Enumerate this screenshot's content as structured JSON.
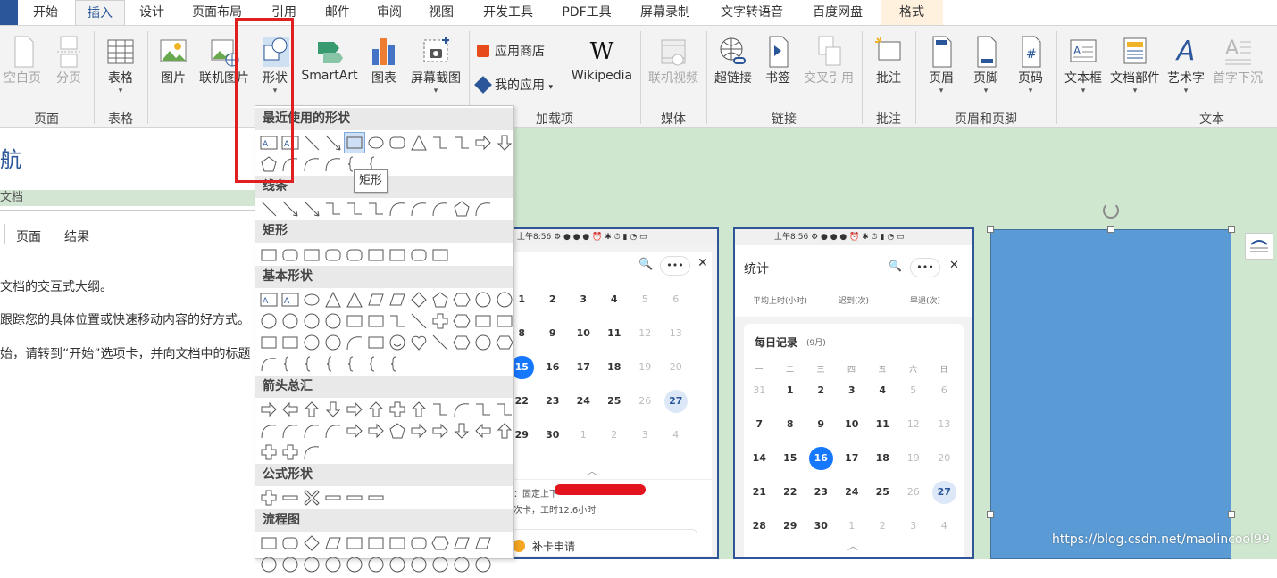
{
  "tabs": [
    "开始",
    "插入",
    "设计",
    "页面布局",
    "引用",
    "邮件",
    "审阅",
    "视图",
    "开发工具",
    "PDF工具",
    "屏幕录制",
    "文字转语音",
    "百度网盘",
    "格式"
  ],
  "ribbon": {
    "blank_page": "空白页",
    "page_break": "分页",
    "table": "表格",
    "picture": "图片",
    "online_picture": "联机图片",
    "shapes": "形状",
    "smartart": "SmartArt",
    "chart": "图表",
    "screenshot": "屏幕截图",
    "app_store": "应用商店",
    "my_apps": "我的应用",
    "wikipedia": "Wikipedia",
    "online_video": "联机视频",
    "hyperlink": "超链接",
    "bookmark": "书签",
    "cross_ref": "交叉引用",
    "comment": "批注",
    "header": "页眉",
    "footer": "页脚",
    "page_num": "页码",
    "textbox": "文本框",
    "doc_parts": "文档部件",
    "wordart": "艺术字",
    "dropcap": "首字下沉"
  },
  "groups": {
    "pages": "页面",
    "tables": "表格",
    "addins": "加载项",
    "media": "媒体",
    "links": "链接",
    "comments": "批注",
    "header_footer": "页眉和页脚",
    "text": "文本"
  },
  "nav": {
    "title_fragment": "航",
    "subtitle": "文档",
    "tabs": [
      "页面",
      "结果"
    ],
    "line1": "文档的交互式大纲。",
    "line2": "跟踪您的具体位置或快速移动内容的好方式。",
    "line3": "始，请转到“开始”选项卡，并向文档中的标题"
  },
  "menu": {
    "recent": "最近使用的形状",
    "lines": "线条",
    "rect": "矩形",
    "basic": "基本形状",
    "arrows": "箭头总汇",
    "equation": "公式形状",
    "flowchart": "流程图",
    "tooltip": "矩形"
  },
  "phone1": {
    "status": "上午8:56",
    "weeks": [
      [
        "1",
        "2",
        "3",
        "4",
        "5",
        "6"
      ],
      [
        "8",
        "9",
        "10",
        "11",
        "12",
        "13"
      ],
      [
        "15",
        "16",
        "17",
        "18",
        "19",
        "20"
      ],
      [
        "22",
        "23",
        "24",
        "25",
        "26",
        "27"
      ],
      [
        "29",
        "30",
        "1",
        "2",
        "3",
        "4"
      ]
    ],
    "note1": "：固定上下",
    "note2": "次卡，工时12.6小时",
    "button": "补卡申请"
  },
  "phone2": {
    "status": "上午8:56",
    "title": "统计",
    "stats_row": [
      "平均上时(小时)",
      "迟到(次)",
      "早退(次)"
    ],
    "daily": "每日记录",
    "month": "(9月)",
    "weekdays": [
      "一",
      "二",
      "三",
      "四",
      "五",
      "六",
      "日"
    ],
    "weeks": [
      [
        "31",
        "1",
        "2",
        "3",
        "4",
        "5",
        "6"
      ],
      [
        "7",
        "8",
        "9",
        "10",
        "11",
        "12",
        "13"
      ],
      [
        "14",
        "15",
        "16",
        "17",
        "18",
        "19",
        "20"
      ],
      [
        "21",
        "22",
        "23",
        "24",
        "25",
        "26",
        "27"
      ],
      [
        "28",
        "29",
        "30",
        "1",
        "2",
        "3",
        "4"
      ]
    ]
  },
  "watermark": "https://blog.csdn.net/maolincool99",
  "colors": {
    "word_blue": "#2b579a",
    "green_bg": "#cfe6cf",
    "shape_fill": "#5b9bd5",
    "red": "#e02020",
    "highlight_blue": "#1677ff"
  }
}
